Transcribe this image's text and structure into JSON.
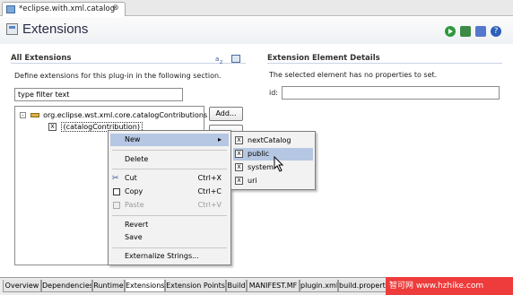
{
  "editor_tab": {
    "title": "*eclipse.with.xml.catalog",
    "close": "⊗"
  },
  "header": {
    "title": "Extensions"
  },
  "all_extensions": {
    "title": "All Extensions",
    "description": "Define extensions for this plug-in in the following section.",
    "filter_value": "type filter text",
    "tree": {
      "root": "org.eclipse.wst.xml.core.catalogContributions",
      "child": "(catalogContribution)"
    },
    "add_button": "Add..."
  },
  "details": {
    "title": "Extension Element Details",
    "message": "The selected element has no properties to set.",
    "id_label": "id:"
  },
  "context_menu": {
    "new": "New",
    "delete": "Delete",
    "cut": "Cut",
    "cut_key": "Ctrl+X",
    "copy": "Copy",
    "copy_key": "Ctrl+C",
    "paste": "Paste",
    "paste_key": "Ctrl+V",
    "revert": "Revert",
    "save": "Save",
    "externalize": "Externalize Strings..."
  },
  "submenu": {
    "items": [
      "nextCatalog",
      "public",
      "system",
      "uri"
    ],
    "selected": "public"
  },
  "bottom_tabs": [
    "Overview",
    "Dependencies",
    "Runtime",
    "Extensions",
    "Extension Points",
    "Build",
    "MANIFEST.MF",
    "plugin.xml",
    "build.properties"
  ],
  "active_tab": "Extensions",
  "watermark": "智可网 www.hzhike.com",
  "colors": {
    "menu_highlight": "#b6c7e3",
    "watermark": "#ee3b3b"
  }
}
